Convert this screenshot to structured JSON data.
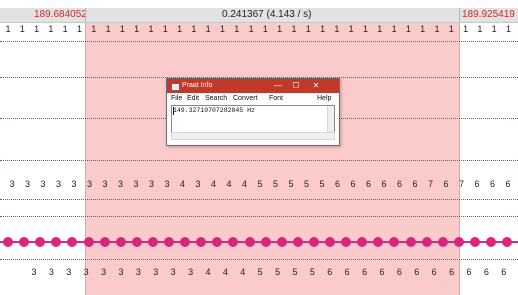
{
  "header": {
    "left_time": "189.684052",
    "selection_duration": "0.241367 (4.143 / s)",
    "right_time": "189.925419"
  },
  "tier1": {
    "labels": [
      "1",
      "1",
      "1",
      "1",
      "1",
      "1",
      "1",
      "1",
      "1",
      "1",
      "1",
      "1",
      "1",
      "1",
      "1",
      "1",
      "1",
      "1",
      "1",
      "1",
      "1",
      "1",
      "1",
      "1",
      "1",
      "1",
      "1",
      "1",
      "1",
      "1",
      "1",
      "1",
      "1",
      "1",
      "1",
      "1"
    ]
  },
  "tier3": {
    "labels": [
      "3",
      "3",
      "3",
      "3",
      "3",
      "3",
      "3",
      "3",
      "3",
      "3",
      "3",
      "4",
      "3",
      "4",
      "4",
      "4",
      "5",
      "5",
      "5",
      "5",
      "5",
      "6",
      "6",
      "6",
      "6",
      "6",
      "6",
      "7",
      "6",
      "7",
      "6",
      "6",
      "6"
    ]
  },
  "tier4": {
    "labels": [
      "3",
      "3",
      "3",
      "3",
      "3",
      "3",
      "3",
      "3",
      "3",
      "3",
      "4",
      "4",
      "4",
      "5",
      "5",
      "5",
      "5",
      "6",
      "6",
      "6",
      "6",
      "6",
      "6",
      "6",
      "6",
      "6",
      "6",
      "6"
    ]
  },
  "dialog": {
    "title": "Praat Info",
    "menu": [
      "File",
      "Edit",
      "Search",
      "Convert",
      "Font",
      "Help"
    ],
    "content": "149.32710707282845 Hz",
    "minimize": "—",
    "maximize": "☐",
    "close": "✕"
  },
  "colors": {
    "selection": "#fbcaca",
    "time_text": "#c0302c",
    "pitch_dots": "#d8267f",
    "dialog_title": "#c0392b"
  }
}
